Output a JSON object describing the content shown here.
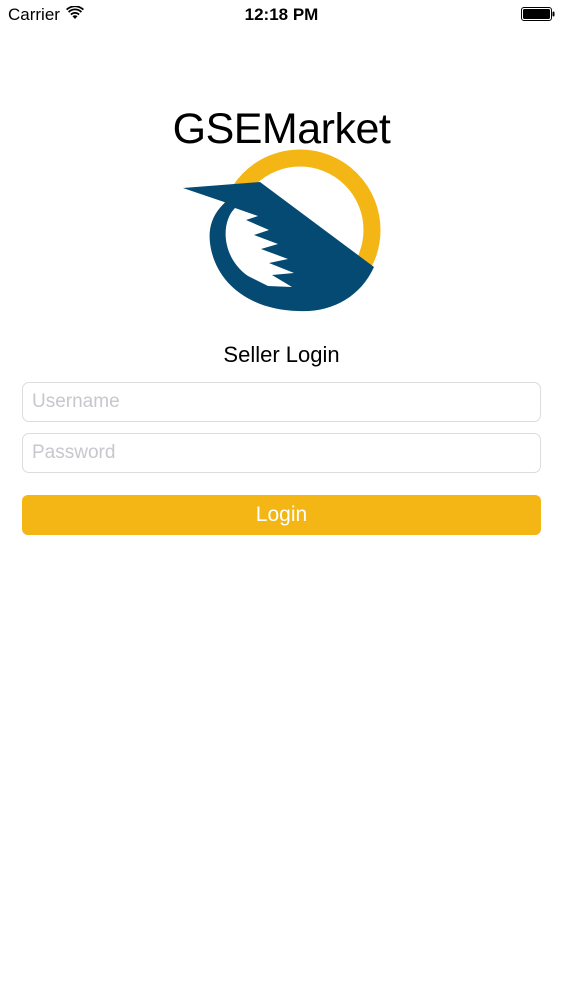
{
  "status_bar": {
    "carrier": "Carrier",
    "time": "12:18 PM",
    "wifi_icon": "wifi-icon",
    "battery_icon": "battery-icon"
  },
  "app": {
    "title": "GSEMarket",
    "logo_icon": "gsemarket-logo",
    "colors": {
      "brand_yellow": "#f3b614",
      "brand_navy": "#054a73"
    }
  },
  "login": {
    "heading": "Seller Login",
    "username_placeholder": "Username",
    "password_placeholder": "Password",
    "button_label": "Login"
  }
}
